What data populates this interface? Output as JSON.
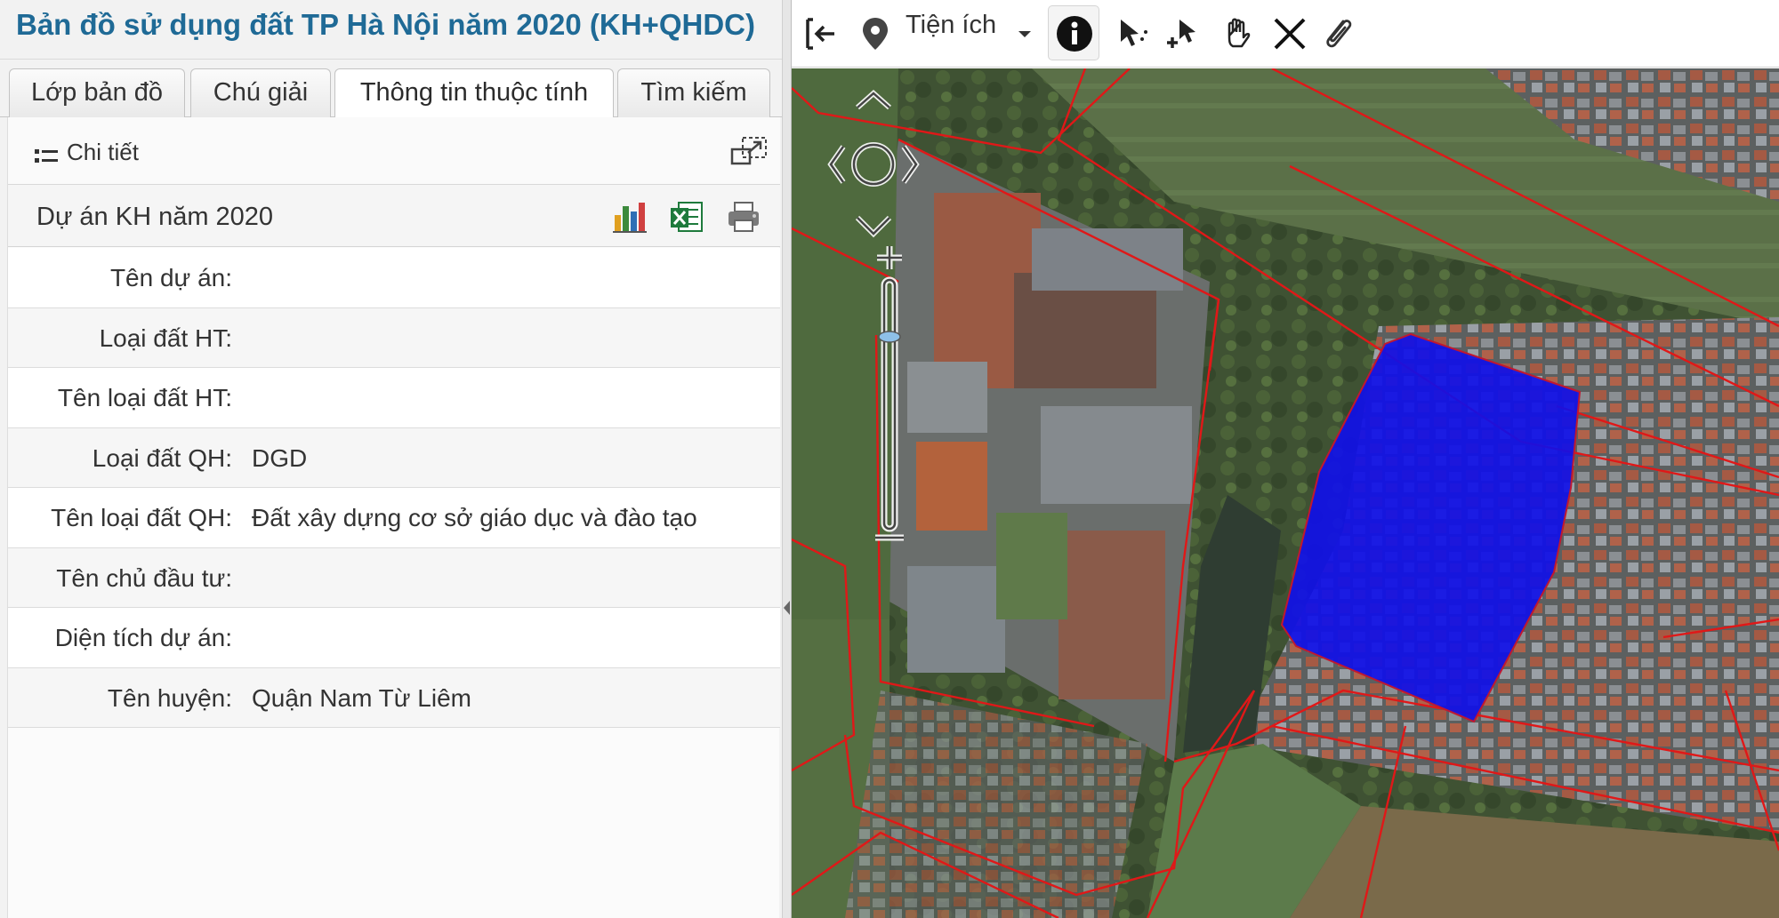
{
  "app": {
    "title": "Bản đồ sử dụng đất TP Hà Nội năm 2020 (KH+QHDC)"
  },
  "tabs": [
    {
      "label": "Lớp bản đồ",
      "active": false
    },
    {
      "label": "Chú giải",
      "active": false
    },
    {
      "label": "Thông tin thuộc tính",
      "active": true
    },
    {
      "label": "Tìm kiếm",
      "active": false
    }
  ],
  "detail": {
    "label": "Chi tiết",
    "icon": "list-icon",
    "expand_icon": "expand-icon"
  },
  "layer": {
    "name": "Dự án KH năm 2020",
    "actions": [
      "chart-icon",
      "excel-icon",
      "print-icon"
    ]
  },
  "attributes": [
    {
      "key": "Tên dự án:",
      "value": ""
    },
    {
      "key": "Loại đất HT:",
      "value": ""
    },
    {
      "key": "Tên loại đất HT:",
      "value": ""
    },
    {
      "key": "Loại đất QH:",
      "value": "DGD"
    },
    {
      "key": "Tên loại đất QH:",
      "value": "Đất xây dựng cơ sở giáo dục và đào tạo"
    },
    {
      "key": "Tên chủ đầu tư:",
      "value": ""
    },
    {
      "key": "Diện tích dự án:",
      "value": ""
    },
    {
      "key": "Tên huyện:",
      "value": "Quận Nam Từ Liêm"
    }
  ],
  "toolbar": {
    "utilities_label": "Tiện ích",
    "icons": [
      "exit-icon",
      "location-pin-icon",
      "dropdown-caret-icon",
      "info-icon",
      "select-arrow-icon",
      "select-add-icon",
      "pan-hand-icon",
      "clear-icon",
      "attach-icon"
    ]
  },
  "colors": {
    "title": "#1f6a96",
    "parcel_border": "#e01818",
    "selected_parcel": "#1010e8",
    "excel_green": "#1e7a3c"
  }
}
